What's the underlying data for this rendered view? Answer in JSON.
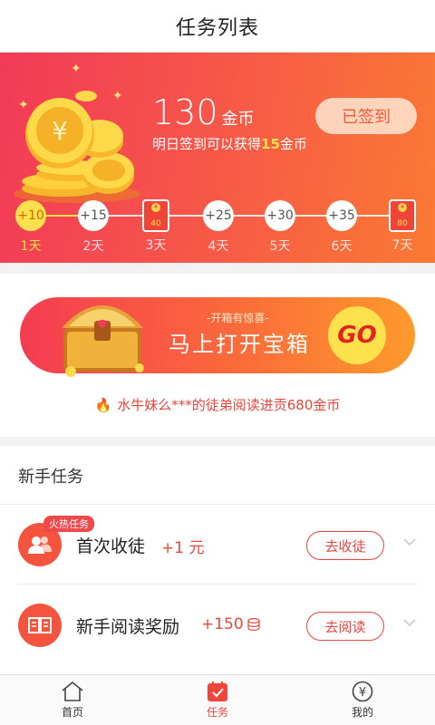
{
  "header": {
    "title": "任务列表"
  },
  "checkin": {
    "coin_total": "130",
    "coin_unit": "金币",
    "tomorrow_prefix": "明日签到可以获得",
    "tomorrow_amount": "15",
    "tomorrow_suffix": "金币",
    "signed_label": "已签到",
    "days": [
      {
        "reward": "+10",
        "label": "1天"
      },
      {
        "reward": "+15",
        "label": "2天"
      },
      {
        "reward": "40",
        "label": "3天"
      },
      {
        "reward": "+25",
        "label": "4天"
      },
      {
        "reward": "+30",
        "label": "5天"
      },
      {
        "reward": "+35",
        "label": "6天"
      },
      {
        "reward": "80",
        "label": "7天"
      }
    ]
  },
  "treasure": {
    "subtitle": "-开箱有惊喜-",
    "title": "马上打开宝箱",
    "go_label": "GO",
    "notice": "水牛妹么***的徒弟阅读进贡680金币"
  },
  "tasks": {
    "section_title": "新手任务",
    "items": [
      {
        "badge": "火热任务",
        "name": "首次收徒",
        "reward": "+1 元",
        "button": "去收徒"
      },
      {
        "badge": "",
        "name": "新手阅读奖励",
        "reward": "+150",
        "button": "去阅读"
      }
    ]
  },
  "tabbar": {
    "items": [
      {
        "label": "首页"
      },
      {
        "label": "任务"
      },
      {
        "label": "我的"
      }
    ]
  },
  "colors": {
    "accent": "#f0453b",
    "gold": "#ffe04d"
  }
}
